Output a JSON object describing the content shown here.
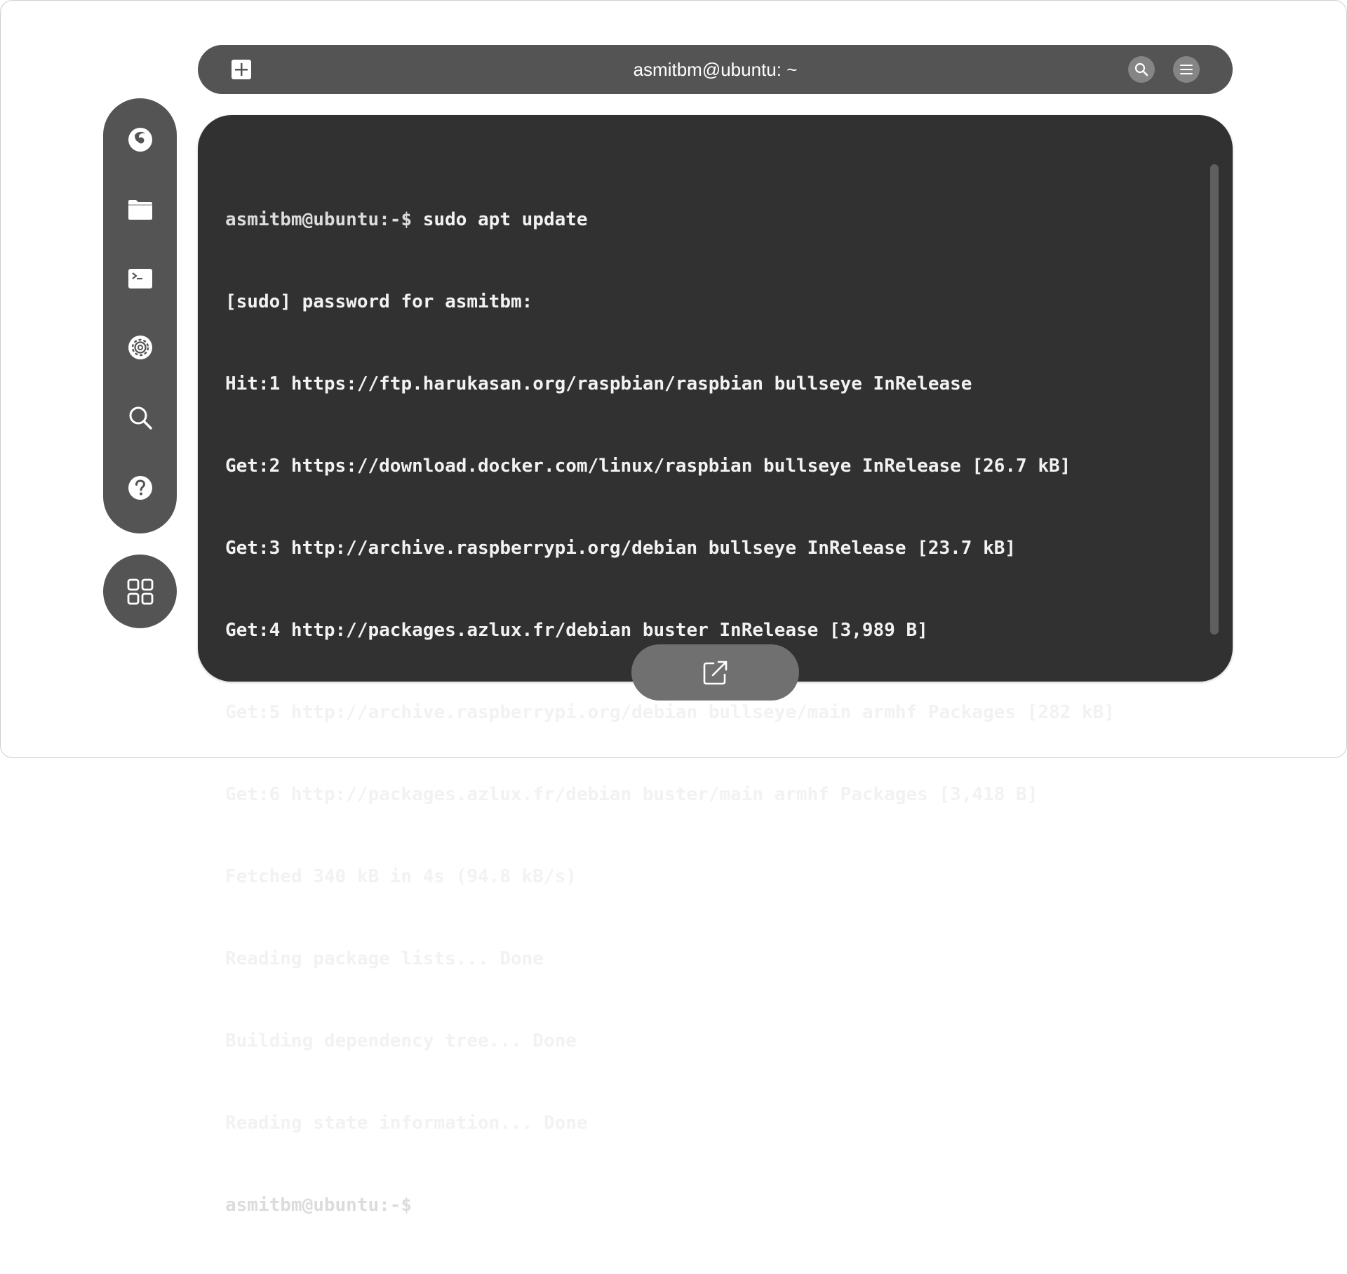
{
  "window": {
    "title": "asmitbm@ubuntu: ~"
  },
  "headerbar": {
    "icons": [
      "new-tab-icon",
      "search-icon",
      "menu-icon"
    ]
  },
  "dock": {
    "items": [
      {
        "name": "firefox",
        "icon": "firefox-icon"
      },
      {
        "name": "files",
        "icon": "folder-icon"
      },
      {
        "name": "terminal",
        "icon": "terminal-icon"
      },
      {
        "name": "settings",
        "icon": "gear-icon"
      },
      {
        "name": "search",
        "icon": "search-icon"
      },
      {
        "name": "help",
        "icon": "help-icon"
      }
    ],
    "apps_icon": "app-grid-icon"
  },
  "terminal": {
    "prompt": "asmitbm@ubuntu:-$",
    "command": " sudo apt update",
    "lines": [
      "[sudo] password for asmitbm:",
      "Hit:1 https://ftp.harukasan.org/raspbian/raspbian bullseye InRelease",
      "Get:2 https://download.docker.com/linux/raspbian bullseye InRelease [26.7 kB]",
      "Get:3 http://archive.raspberrypi.org/debian bullseye InRelease [23.7 kB]",
      "Get:4 http://packages.azlux.fr/debian buster InRelease [3,989 B]",
      "Get:5 http://archive.raspberrypi.org/debian bullseye/main armhf Packages [282 kB]",
      "Get:6 http://packages.azlux.fr/debian buster/main armhf Packages [3,418 B]",
      "Fetched 340 kB in 4s (94.8 kB/s)",
      "Reading package lists... Done",
      "Building dependency tree... Done",
      "Reading state information... Done"
    ],
    "final_prompt": "asmitbm@ubuntu:-$"
  },
  "popout": {
    "icon": "external-link-icon"
  },
  "colors": {
    "chrome": "#545454",
    "terminal_bg": "#313131",
    "text": "#f2f2f2"
  }
}
